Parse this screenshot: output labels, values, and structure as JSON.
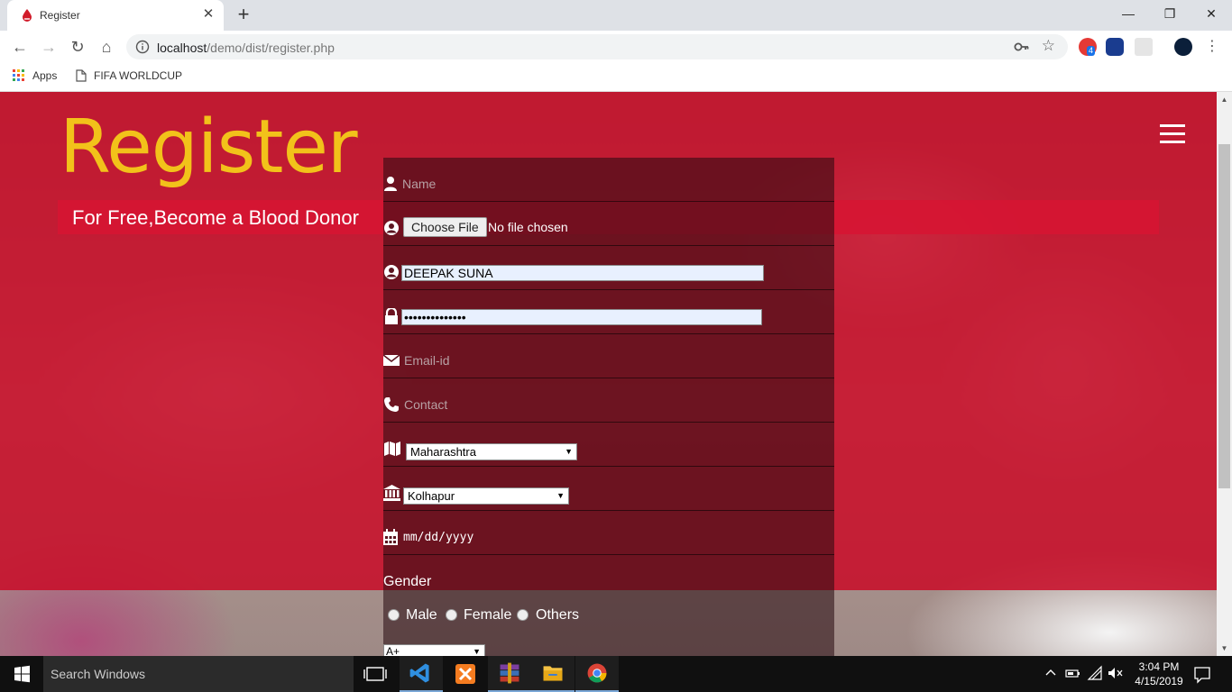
{
  "browser": {
    "tab_title": "Register",
    "url_host": "localhost",
    "url_path": "/demo/dist/register.php",
    "bookmarks": [
      "Apps",
      "FIFA WORLDCUP"
    ],
    "extension_badge": "4"
  },
  "page": {
    "brand": "Register",
    "tagline": "For Free,Become a Blood Donor"
  },
  "form": {
    "name_placeholder": "Name",
    "file_button": "Choose File",
    "file_status": "No file chosen",
    "username_value": "DEEPAK SUNA",
    "password_value": "••••••••••••••",
    "email_placeholder": "Email-id",
    "contact_placeholder": "Contact",
    "state_selected": "Maharashtra",
    "city_selected": "Kolhapur",
    "date_placeholder": "mm/dd/yyyy",
    "gender_label": "Gender",
    "gender_options": [
      "Male",
      "Female",
      "Others"
    ],
    "blood_group_selected": "A+"
  },
  "taskbar": {
    "search_placeholder": "Search Windows",
    "time": "3:04 PM",
    "date": "4/15/2019"
  },
  "colors": {
    "overlay_red": "#c80c28",
    "brand_yellow": "#f2c21a"
  }
}
